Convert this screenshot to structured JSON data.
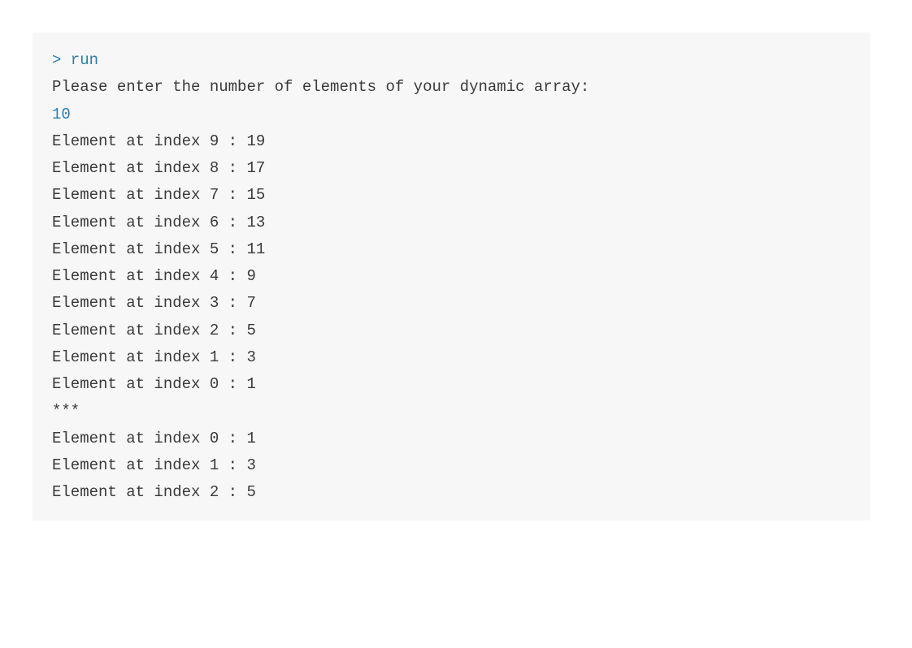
{
  "colors": {
    "terminal_bg": "#f7f7f7",
    "prompt_color": "#2c7db3",
    "text_color": "#3a3a3a"
  },
  "prompt": "> run",
  "prompt_question": "Please enter the number of elements of your dynamic array:",
  "user_input": "10",
  "line_prefix": "Element at index ",
  "separator": "***",
  "first_block": [
    {
      "index": 9,
      "value": 19
    },
    {
      "index": 8,
      "value": 17
    },
    {
      "index": 7,
      "value": 15
    },
    {
      "index": 6,
      "value": 13
    },
    {
      "index": 5,
      "value": 11
    },
    {
      "index": 4,
      "value": 9
    },
    {
      "index": 3,
      "value": 7
    },
    {
      "index": 2,
      "value": 5
    },
    {
      "index": 1,
      "value": 3
    },
    {
      "index": 0,
      "value": 1
    }
  ],
  "second_block": [
    {
      "index": 0,
      "value": 1
    },
    {
      "index": 1,
      "value": 3
    },
    {
      "index": 2,
      "value": 5
    }
  ]
}
